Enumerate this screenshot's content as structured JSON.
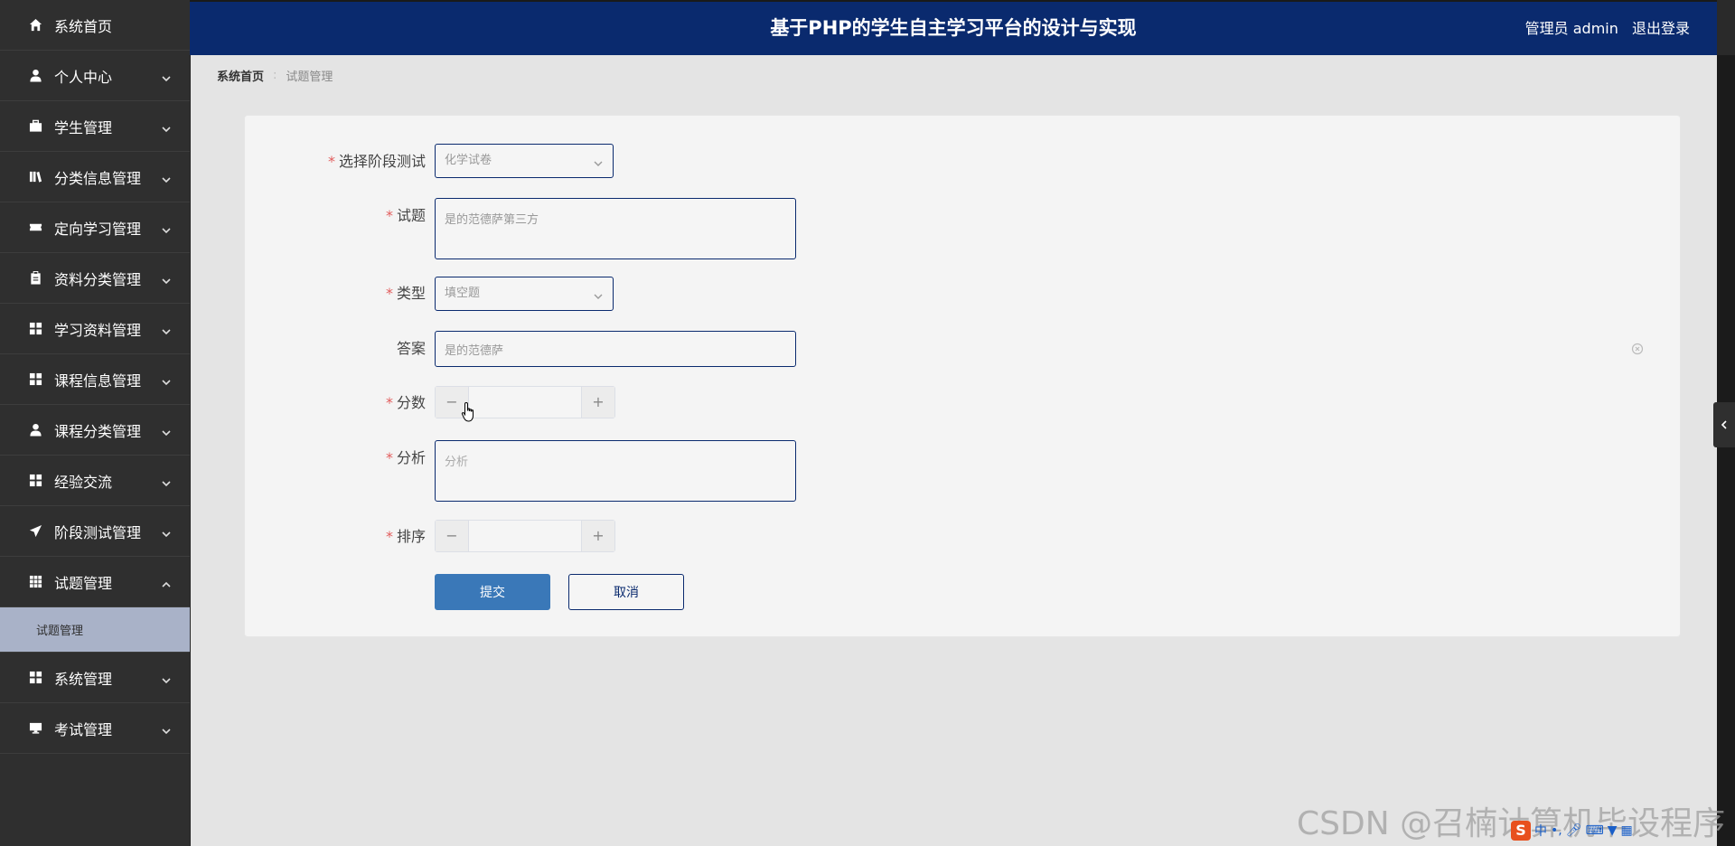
{
  "header": {
    "title": "基于PHP的学生自主学习平台的设计与实现",
    "user": "管理员 admin",
    "logout": "退出登录"
  },
  "sidebar": {
    "items": [
      {
        "label": "系统首页",
        "icon": "home-icon",
        "expanded": false,
        "has_chevron": false
      },
      {
        "label": "个人中心",
        "icon": "user-icon",
        "has_chevron": true
      },
      {
        "label": "学生管理",
        "icon": "briefcase-icon",
        "has_chevron": true
      },
      {
        "label": "分类信息管理",
        "icon": "library-icon",
        "has_chevron": true
      },
      {
        "label": "定向学习管理",
        "icon": "ticket-icon",
        "has_chevron": true
      },
      {
        "label": "资料分类管理",
        "icon": "clipboard-icon",
        "has_chevron": true
      },
      {
        "label": "学习资料管理",
        "icon": "grid-icon",
        "has_chevron": true
      },
      {
        "label": "课程信息管理",
        "icon": "grid-icon",
        "has_chevron": true
      },
      {
        "label": "课程分类管理",
        "icon": "user-icon",
        "has_chevron": true
      },
      {
        "label": "经验交流",
        "icon": "grid-icon",
        "has_chevron": true
      },
      {
        "label": "阶段测试管理",
        "icon": "send-icon",
        "has_chevron": true
      },
      {
        "label": "试题管理",
        "icon": "table-icon",
        "has_chevron": true,
        "expanded": true
      },
      {
        "label": "系统管理",
        "icon": "grid-icon",
        "has_chevron": true
      },
      {
        "label": "考试管理",
        "icon": "monitor-icon",
        "has_chevron": true
      }
    ],
    "submenu": {
      "label": "试题管理"
    }
  },
  "breadcrumb": {
    "home": "系统首页",
    "current": "试题管理"
  },
  "form": {
    "stage_test": {
      "label": "选择阶段测试",
      "value": "化学试卷"
    },
    "question": {
      "label": "试题",
      "value": "是的范德萨第三方"
    },
    "type": {
      "label": "类型",
      "value": "填空题"
    },
    "answer": {
      "label": "答案",
      "value": "是的范德萨"
    },
    "score": {
      "label": "分数",
      "value": ""
    },
    "analysis": {
      "label": "分析",
      "placeholder": "分析"
    },
    "sort": {
      "label": "排序",
      "value": ""
    },
    "submit": "提交",
    "cancel": "取消"
  },
  "watermark": "CSDN @召楠计算机毕设程序",
  "ime": {
    "lang": "中"
  },
  "colors": {
    "header": "#0a2a6e",
    "sidebar": "#2f2f2f",
    "primary": "#3a78b8",
    "required": "#e25d5d"
  }
}
